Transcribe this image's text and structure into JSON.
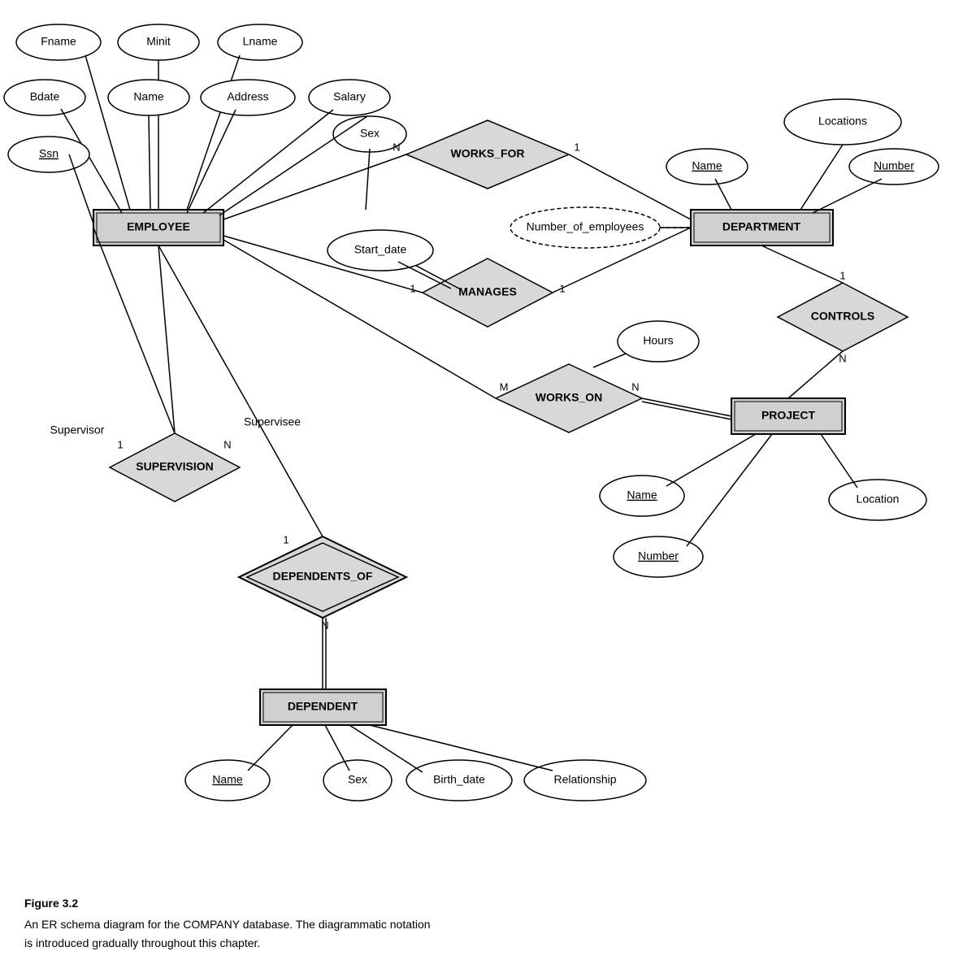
{
  "diagram": {
    "title": "Figure 3.2",
    "caption_line1": "An ER schema diagram for the COMPANY database. The diagrammatic notation",
    "caption_line2": "is introduced gradually throughout this chapter.",
    "entities": {
      "employee": "EMPLOYEE",
      "department": "DEPARTMENT",
      "project": "PROJECT",
      "dependent": "DEPENDENT"
    },
    "relationships": {
      "works_for": "WORKS_FOR",
      "manages": "MANAGES",
      "works_on": "WORKS_ON",
      "controls": "CONTROLS",
      "supervision": "SUPERVISION",
      "dependents_of": "DEPENDENTS_OF"
    },
    "attributes": {
      "fname": "Fname",
      "minit": "Minit",
      "lname": "Lname",
      "bdate": "Bdate",
      "name_emp": "Name",
      "address": "Address",
      "salary": "Salary",
      "ssn": "Ssn",
      "sex_emp": "Sex",
      "start_date": "Start_date",
      "number_of_employees": "Number_of_employees",
      "locations": "Locations",
      "dept_name": "Name",
      "dept_number": "Number",
      "hours": "Hours",
      "proj_name": "Name",
      "proj_number": "Number",
      "location": "Location",
      "dep_name": "Name",
      "dep_sex": "Sex",
      "birth_date": "Birth_date",
      "relationship": "Relationship"
    },
    "cardinalities": {
      "works_for_emp": "N",
      "works_for_dept": "1",
      "manages_emp": "1",
      "manages_dept": "1",
      "works_on_emp": "M",
      "works_on_proj": "N",
      "controls_dept": "1",
      "controls_proj": "N",
      "supervision_supervisor": "1",
      "supervision_supervisee": "N",
      "dependents_of_emp": "1",
      "dependents_of_dep": "N"
    }
  }
}
